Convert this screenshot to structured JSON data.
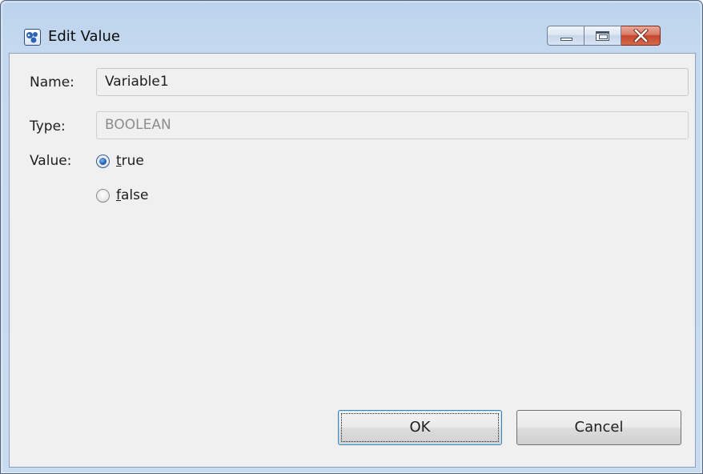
{
  "window": {
    "title": "Edit Value",
    "app_icon": "app-logo-icon",
    "controls": [
      "minimize-icon",
      "maximize-icon",
      "close-icon"
    ]
  },
  "form": {
    "name_label": "Name:",
    "name_value": "Variable1",
    "type_label": "Type:",
    "type_value": "BOOLEAN",
    "value_label": "Value:",
    "options": [
      {
        "mnemonic": "t",
        "rest": "rue",
        "selected": true
      },
      {
        "mnemonic": "f",
        "rest": "alse",
        "selected": false
      }
    ]
  },
  "buttons": {
    "ok": "OK",
    "cancel": "Cancel"
  },
  "colors": {
    "frame": "#c4d9ef",
    "client": "#f0f0f0",
    "close_button": "#c4452b",
    "default_button_border": "#3c7fb1"
  }
}
